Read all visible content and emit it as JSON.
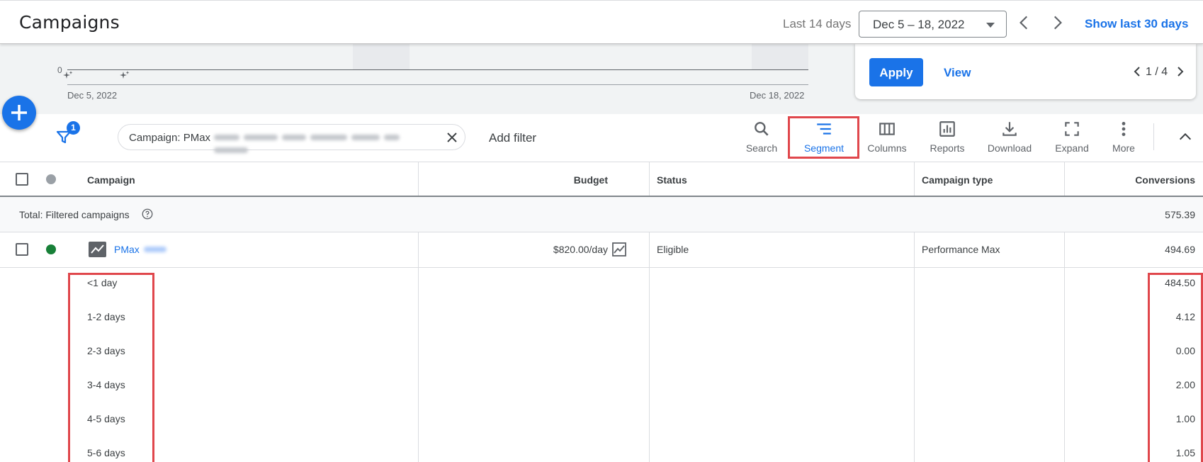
{
  "header": {
    "title": "Campaigns",
    "range_label": "Last 14 days",
    "date_range": "Dec 5 – 18, 2022",
    "show_last_30": "Show last 30 days"
  },
  "chart": {
    "y_zero": "0",
    "start_date": "Dec 5, 2022",
    "end_date": "Dec 18, 2022"
  },
  "recommendation_card": {
    "apply_label": "Apply",
    "view_label": "View",
    "pager": "1 / 4"
  },
  "toolbar": {
    "filter_count": "1",
    "filter_chip_label": "Campaign: PMax",
    "add_filter": "Add filter",
    "tools": [
      {
        "label": "Search",
        "icon": "search-icon"
      },
      {
        "label": "Segment",
        "icon": "segment-icon",
        "active": true
      },
      {
        "label": "Columns",
        "icon": "columns-icon"
      },
      {
        "label": "Reports",
        "icon": "reports-icon"
      },
      {
        "label": "Download",
        "icon": "download-icon"
      },
      {
        "label": "Expand",
        "icon": "expand-icon"
      },
      {
        "label": "More",
        "icon": "more-vert-icon"
      }
    ]
  },
  "table": {
    "columns": [
      "Campaign",
      "Budget",
      "Status",
      "Campaign type",
      "Conversions"
    ],
    "total": {
      "label": "Total: Filtered campaigns",
      "conversions": "575.39"
    },
    "campaign": {
      "name": "PMax",
      "budget": "$820.00/day",
      "status": "Eligible",
      "type": "Performance Max",
      "conversions": "494.69"
    },
    "segments": [
      {
        "label": "<1 day",
        "conversions": "484.50"
      },
      {
        "label": "1-2 days",
        "conversions": "4.12"
      },
      {
        "label": "2-3 days",
        "conversions": "0.00"
      },
      {
        "label": "3-4 days",
        "conversions": "2.00"
      },
      {
        "label": "4-5 days",
        "conversions": "1.00"
      },
      {
        "label": "5-6 days",
        "conversions": "1.05"
      }
    ]
  },
  "colors": {
    "accent": "#1a73e8",
    "highlight": "#e0474c",
    "eligible": "#188038"
  }
}
